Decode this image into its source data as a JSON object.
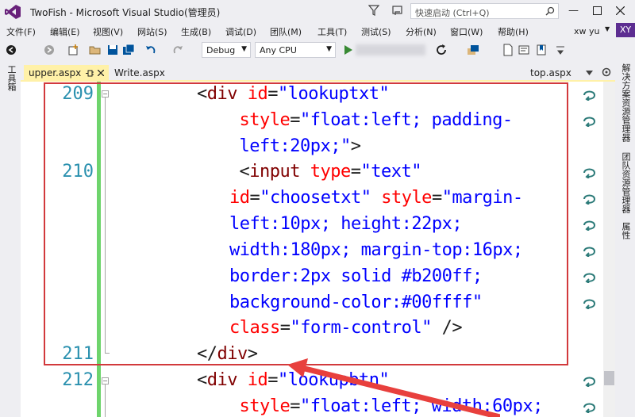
{
  "title": "TwoFish - Microsoft Visual Studio(管理员)",
  "quick_launch": {
    "placeholder": "快速启动 (Ctrl+Q)"
  },
  "window_controls": {
    "minimize": "—"
  },
  "menu": [
    "文件(F)",
    "编辑(E)",
    "视图(V)",
    "网站(S)",
    "生成(B)",
    "调试(D)",
    "团队(M)",
    "工具(T)",
    "测试(S)",
    "分析(N)",
    "窗口(W)",
    "帮助(H)"
  ],
  "user": {
    "name": "xw yu",
    "initials": "XY"
  },
  "toolbar": {
    "config": "Debug",
    "platform": "Any CPU"
  },
  "left_strip": {
    "toolbox": "工具箱"
  },
  "right_strip": {
    "solution_explorer": "解决方案资源管理器",
    "team_explorer": "团队资源管理器",
    "properties": "属性"
  },
  "tabs": {
    "active": "upper.aspx",
    "second": "Write.aspx",
    "right": "top.aspx"
  },
  "editor": {
    "line_numbers": [
      "209",
      "210",
      "211",
      "212"
    ],
    "lines": [
      [
        [
          "p",
          "<"
        ],
        [
          "t",
          "div"
        ],
        [
          "p",
          " "
        ],
        [
          "a",
          "id"
        ],
        [
          "p",
          "="
        ],
        [
          "v",
          "\"lookuptxt\""
        ]
      ],
      [
        [
          "p",
          "  "
        ],
        [
          "a",
          "style"
        ],
        [
          "p",
          "="
        ],
        [
          "v",
          "\"float:left; padding-"
        ]
      ],
      [
        [
          "p",
          "  "
        ],
        [
          "v",
          "left:20px;\""
        ],
        [
          "p",
          ">"
        ]
      ],
      [
        [
          "p",
          "  "
        ],
        [
          "p",
          "<"
        ],
        [
          "t",
          "input"
        ],
        [
          "p",
          " "
        ],
        [
          "a",
          "type"
        ],
        [
          "p",
          "="
        ],
        [
          "v",
          "\"text\""
        ]
      ],
      [
        [
          "a",
          "id"
        ],
        [
          "p",
          "="
        ],
        [
          "v",
          "\"choosetxt\""
        ],
        [
          "p",
          " "
        ],
        [
          "a",
          "style"
        ],
        [
          "p",
          "="
        ],
        [
          "v",
          "\"margin-"
        ]
      ],
      [
        [
          "v",
          "left:10px; height:22px;"
        ]
      ],
      [
        [
          "v",
          "width:180px; margin-top:16px;"
        ]
      ],
      [
        [
          "v",
          "border:2px solid #b200ff;"
        ]
      ],
      [
        [
          "v",
          "background-color:#00ffff\""
        ]
      ],
      [
        [
          "a",
          "class"
        ],
        [
          "p",
          "="
        ],
        [
          "v",
          "\"form-control\""
        ],
        [
          "p",
          " />"
        ]
      ],
      [
        [
          "p",
          "</"
        ],
        [
          "t",
          "div"
        ],
        [
          "p",
          ">"
        ]
      ],
      [
        [
          "p",
          "<"
        ],
        [
          "t",
          "div"
        ],
        [
          "p",
          " "
        ],
        [
          "a",
          "id"
        ],
        [
          "p",
          "="
        ],
        [
          "v",
          "\"lookupbtn\""
        ]
      ],
      [
        [
          "p",
          "  "
        ],
        [
          "a",
          "style"
        ],
        [
          "p",
          "="
        ],
        [
          "v",
          "\"float:left; width:60px;"
        ]
      ]
    ]
  },
  "colors": {
    "accent": "#68217a",
    "tab_active": "#fff1a8",
    "annotation": "#d2393c",
    "change_bar": "#6ed46c",
    "line_number": "#2b91af"
  }
}
